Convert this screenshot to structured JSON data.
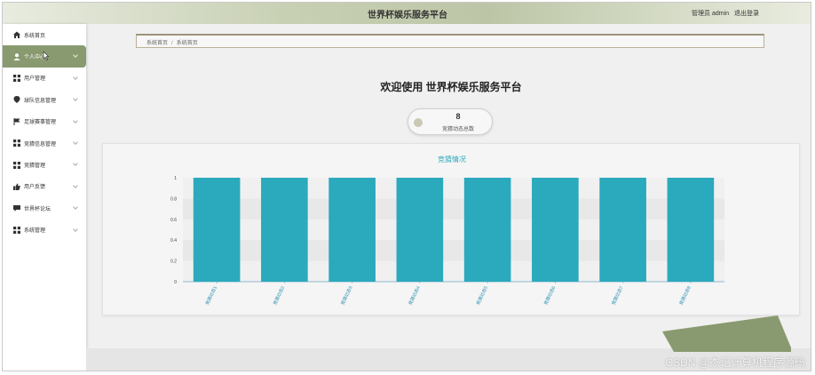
{
  "header": {
    "title": "世界杯娱乐服务平台",
    "user_label": "管理员 admin",
    "logout_label": "退出登录"
  },
  "sidebar": {
    "items": [
      {
        "label": "系统首页",
        "icon": "home-icon"
      },
      {
        "label": "个人中心",
        "icon": "user-icon"
      },
      {
        "label": "用户管理",
        "icon": "grid-icon"
      },
      {
        "label": "球队信息管理",
        "icon": "location-icon"
      },
      {
        "label": "足球赛事管理",
        "icon": "flag-icon"
      },
      {
        "label": "竞猜信息管理",
        "icon": "grid-icon"
      },
      {
        "label": "竞猜管理",
        "icon": "grid-icon"
      },
      {
        "label": "用户反馈",
        "icon": "thumb-icon"
      },
      {
        "label": "世界杯论坛",
        "icon": "message-icon"
      },
      {
        "label": "系统管理",
        "icon": "grid-icon"
      }
    ]
  },
  "breadcrumb": {
    "home": "系统首页",
    "separator": "/",
    "current": "系统首页"
  },
  "main": {
    "welcome": "欢迎使用 世界杯娱乐服务平台",
    "stat": {
      "value": "8",
      "label": "竞猜动态总数"
    }
  },
  "chart_data": {
    "type": "bar",
    "title": "竞猜情况",
    "categories": [
      "竞猜动态1",
      "竞猜动态2",
      "竞猜动态3",
      "竞猜动态4",
      "竞猜动态5",
      "竞猜动态6",
      "竞猜动态7",
      "竞猜动态8"
    ],
    "values": [
      1,
      1,
      1,
      1,
      1,
      1,
      1,
      1
    ],
    "ylim": [
      0,
      1
    ],
    "yticks": [
      "0",
      "0.2",
      "0.4",
      "0.6",
      "0.8",
      "1"
    ],
    "color": "#2ba9bd"
  },
  "watermark": "CSDN @杰记计算机程序源码",
  "colors": {
    "accent": "#8a9a70",
    "bar": "#2ba9bd"
  }
}
